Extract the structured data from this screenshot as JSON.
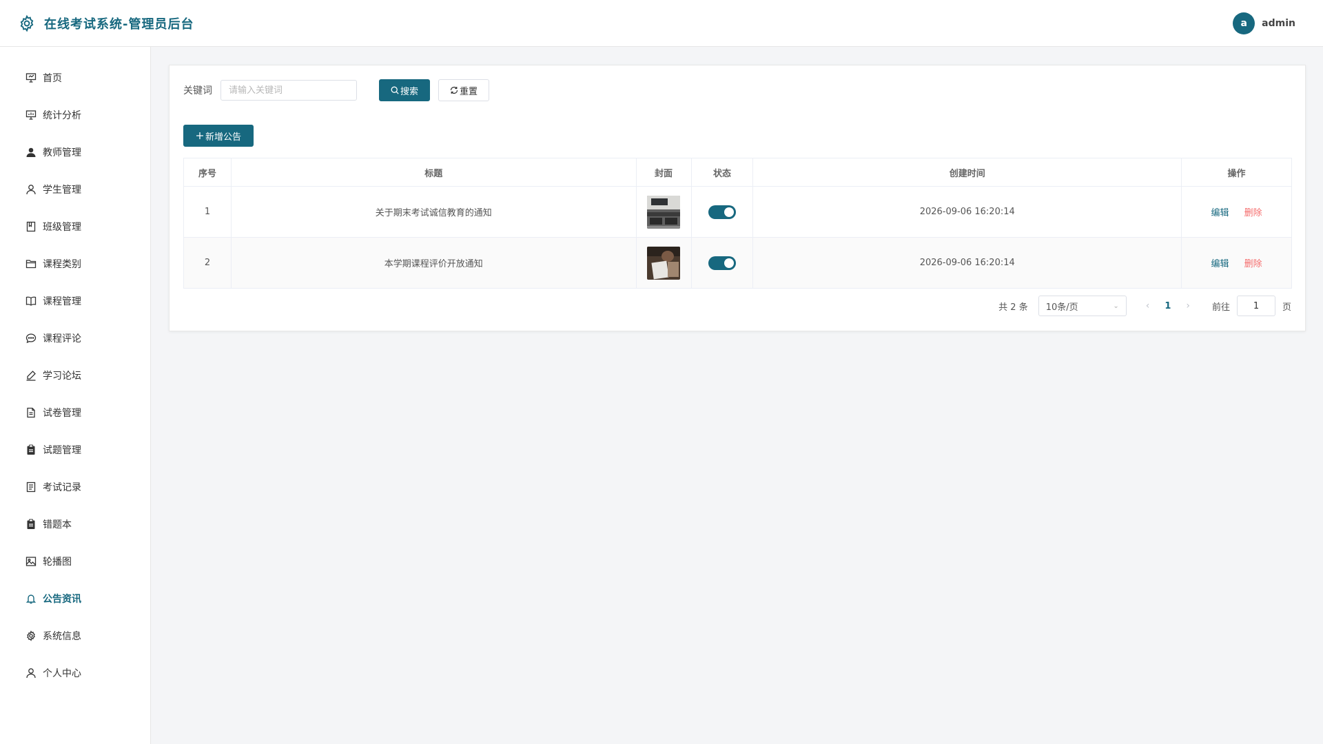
{
  "app": {
    "title": "在线考试系统-管理员后台"
  },
  "user": {
    "avatar_letter": "a",
    "name": "admin"
  },
  "colors": {
    "primary": "#17687f",
    "danger": "#f56c6c"
  },
  "sidebar": {
    "items": [
      {
        "label": "首页",
        "icon": "presentation-icon"
      },
      {
        "label": "统计分析",
        "icon": "chart-board-icon"
      },
      {
        "label": "教师管理",
        "icon": "user-filled-icon"
      },
      {
        "label": "学生管理",
        "icon": "user-icon"
      },
      {
        "label": "班级管理",
        "icon": "notebook-icon"
      },
      {
        "label": "课程类别",
        "icon": "folder-icon"
      },
      {
        "label": "课程管理",
        "icon": "book-icon"
      },
      {
        "label": "课程评论",
        "icon": "chat-icon"
      },
      {
        "label": "学习论坛",
        "icon": "pen-icon"
      },
      {
        "label": "试卷管理",
        "icon": "document-icon"
      },
      {
        "label": "试题管理",
        "icon": "clipboard-icon"
      },
      {
        "label": "考试记录",
        "icon": "tickets-icon"
      },
      {
        "label": "错题本",
        "icon": "clipboard-icon"
      },
      {
        "label": "轮播图",
        "icon": "picture-icon"
      },
      {
        "label": "公告资讯",
        "icon": "bell-icon",
        "active": true
      },
      {
        "label": "系统信息",
        "icon": "gear-icon"
      },
      {
        "label": "个人中心",
        "icon": "user-icon"
      }
    ]
  },
  "search": {
    "label": "关键词",
    "placeholder": "请输入关键词",
    "value": "",
    "search_label": "搜索",
    "reset_label": "重置"
  },
  "toolbar": {
    "add_label": "新增公告"
  },
  "table": {
    "columns": [
      "序号",
      "标题",
      "封面",
      "状态",
      "创建时间",
      "操作"
    ],
    "rows": [
      {
        "index": "1",
        "title": "关于期末考试诚信教育的通知",
        "cover": "classroom-photo",
        "status": true,
        "created": "2026-09-06 16:20:14",
        "edit": "编辑",
        "delete": "删除"
      },
      {
        "index": "2",
        "title": "本学期课程评价开放通知",
        "cover": "student-writing-photo",
        "status": true,
        "created": "2026-09-06 16:20:14",
        "edit": "编辑",
        "delete": "删除"
      }
    ]
  },
  "pagination": {
    "total_text": "共 2 条",
    "page_size": "10条/页",
    "current_page": "1",
    "goto_label": "前往",
    "goto_value": "1",
    "page_suffix": "页"
  }
}
